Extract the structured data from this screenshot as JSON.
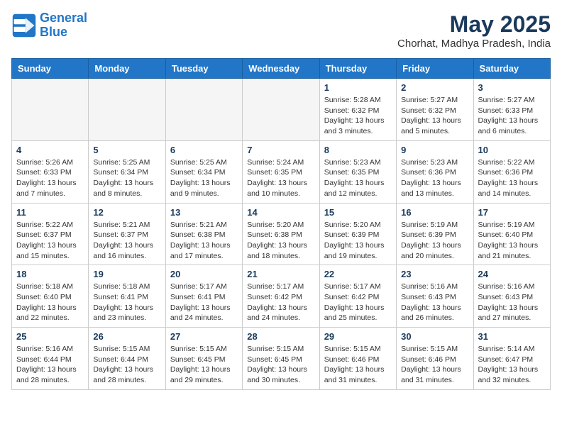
{
  "header": {
    "logo_line1": "General",
    "logo_line2": "Blue",
    "title": "May 2025",
    "subtitle": "Chorhat, Madhya Pradesh, India"
  },
  "columns": [
    "Sunday",
    "Monday",
    "Tuesday",
    "Wednesday",
    "Thursday",
    "Friday",
    "Saturday"
  ],
  "weeks": [
    [
      {
        "day": "",
        "info": ""
      },
      {
        "day": "",
        "info": ""
      },
      {
        "day": "",
        "info": ""
      },
      {
        "day": "",
        "info": ""
      },
      {
        "day": "1",
        "info": "Sunrise: 5:28 AM\nSunset: 6:32 PM\nDaylight: 13 hours\nand 3 minutes."
      },
      {
        "day": "2",
        "info": "Sunrise: 5:27 AM\nSunset: 6:32 PM\nDaylight: 13 hours\nand 5 minutes."
      },
      {
        "day": "3",
        "info": "Sunrise: 5:27 AM\nSunset: 6:33 PM\nDaylight: 13 hours\nand 6 minutes."
      }
    ],
    [
      {
        "day": "4",
        "info": "Sunrise: 5:26 AM\nSunset: 6:33 PM\nDaylight: 13 hours\nand 7 minutes."
      },
      {
        "day": "5",
        "info": "Sunrise: 5:25 AM\nSunset: 6:34 PM\nDaylight: 13 hours\nand 8 minutes."
      },
      {
        "day": "6",
        "info": "Sunrise: 5:25 AM\nSunset: 6:34 PM\nDaylight: 13 hours\nand 9 minutes."
      },
      {
        "day": "7",
        "info": "Sunrise: 5:24 AM\nSunset: 6:35 PM\nDaylight: 13 hours\nand 10 minutes."
      },
      {
        "day": "8",
        "info": "Sunrise: 5:23 AM\nSunset: 6:35 PM\nDaylight: 13 hours\nand 12 minutes."
      },
      {
        "day": "9",
        "info": "Sunrise: 5:23 AM\nSunset: 6:36 PM\nDaylight: 13 hours\nand 13 minutes."
      },
      {
        "day": "10",
        "info": "Sunrise: 5:22 AM\nSunset: 6:36 PM\nDaylight: 13 hours\nand 14 minutes."
      }
    ],
    [
      {
        "day": "11",
        "info": "Sunrise: 5:22 AM\nSunset: 6:37 PM\nDaylight: 13 hours\nand 15 minutes."
      },
      {
        "day": "12",
        "info": "Sunrise: 5:21 AM\nSunset: 6:37 PM\nDaylight: 13 hours\nand 16 minutes."
      },
      {
        "day": "13",
        "info": "Sunrise: 5:21 AM\nSunset: 6:38 PM\nDaylight: 13 hours\nand 17 minutes."
      },
      {
        "day": "14",
        "info": "Sunrise: 5:20 AM\nSunset: 6:38 PM\nDaylight: 13 hours\nand 18 minutes."
      },
      {
        "day": "15",
        "info": "Sunrise: 5:20 AM\nSunset: 6:39 PM\nDaylight: 13 hours\nand 19 minutes."
      },
      {
        "day": "16",
        "info": "Sunrise: 5:19 AM\nSunset: 6:39 PM\nDaylight: 13 hours\nand 20 minutes."
      },
      {
        "day": "17",
        "info": "Sunrise: 5:19 AM\nSunset: 6:40 PM\nDaylight: 13 hours\nand 21 minutes."
      }
    ],
    [
      {
        "day": "18",
        "info": "Sunrise: 5:18 AM\nSunset: 6:40 PM\nDaylight: 13 hours\nand 22 minutes."
      },
      {
        "day": "19",
        "info": "Sunrise: 5:18 AM\nSunset: 6:41 PM\nDaylight: 13 hours\nand 23 minutes."
      },
      {
        "day": "20",
        "info": "Sunrise: 5:17 AM\nSunset: 6:41 PM\nDaylight: 13 hours\nand 24 minutes."
      },
      {
        "day": "21",
        "info": "Sunrise: 5:17 AM\nSunset: 6:42 PM\nDaylight: 13 hours\nand 24 minutes."
      },
      {
        "day": "22",
        "info": "Sunrise: 5:17 AM\nSunset: 6:42 PM\nDaylight: 13 hours\nand 25 minutes."
      },
      {
        "day": "23",
        "info": "Sunrise: 5:16 AM\nSunset: 6:43 PM\nDaylight: 13 hours\nand 26 minutes."
      },
      {
        "day": "24",
        "info": "Sunrise: 5:16 AM\nSunset: 6:43 PM\nDaylight: 13 hours\nand 27 minutes."
      }
    ],
    [
      {
        "day": "25",
        "info": "Sunrise: 5:16 AM\nSunset: 6:44 PM\nDaylight: 13 hours\nand 28 minutes."
      },
      {
        "day": "26",
        "info": "Sunrise: 5:15 AM\nSunset: 6:44 PM\nDaylight: 13 hours\nand 28 minutes."
      },
      {
        "day": "27",
        "info": "Sunrise: 5:15 AM\nSunset: 6:45 PM\nDaylight: 13 hours\nand 29 minutes."
      },
      {
        "day": "28",
        "info": "Sunrise: 5:15 AM\nSunset: 6:45 PM\nDaylight: 13 hours\nand 30 minutes."
      },
      {
        "day": "29",
        "info": "Sunrise: 5:15 AM\nSunset: 6:46 PM\nDaylight: 13 hours\nand 31 minutes."
      },
      {
        "day": "30",
        "info": "Sunrise: 5:15 AM\nSunset: 6:46 PM\nDaylight: 13 hours\nand 31 minutes."
      },
      {
        "day": "31",
        "info": "Sunrise: 5:14 AM\nSunset: 6:47 PM\nDaylight: 13 hours\nand 32 minutes."
      }
    ]
  ]
}
